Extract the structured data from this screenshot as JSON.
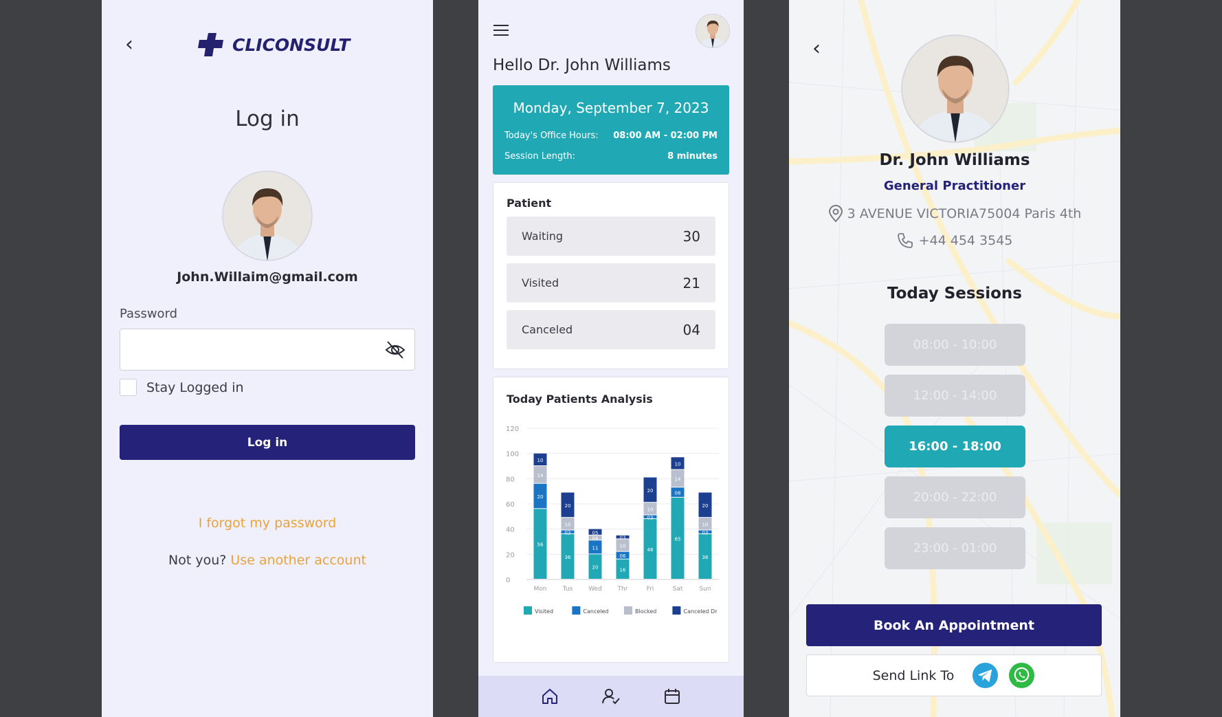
{
  "login": {
    "brand": "CLICONSULT",
    "title": "Log in",
    "email": "John.Willaim@gmail.com",
    "password_label": "Password",
    "stay_logged_in": "Stay Logged in",
    "login_button": "Log in",
    "forgot_password": "I forgot my password",
    "not_you": "Not you?",
    "use_another_account": "Use another account",
    "icons": [
      "back-chevron-icon",
      "brand-cross-icon",
      "eye-off-icon"
    ],
    "colors": {
      "brand": "#25227a",
      "link": "#e8a33d"
    }
  },
  "dashboard": {
    "greeting": "Hello Dr. John Williams",
    "date": "Monday, September 7, 2023",
    "office_hours_label": "Today's Office Hours:",
    "office_hours_value": "08:00 AM - 02:00 PM",
    "session_length_label": "Session Length:",
    "session_length_value": "8 minutes",
    "patient_title": "Patient",
    "stats": [
      {
        "label": "Waiting",
        "value": "30"
      },
      {
        "label": "Visited",
        "value": "21"
      },
      {
        "label": "Canceled",
        "value": "04"
      }
    ],
    "chart_title": "Today Patients Analysis",
    "nav_icons": [
      "home-icon",
      "patient-check-icon",
      "calendar-icon"
    ],
    "colors": {
      "accent": "#20a9b5"
    }
  },
  "chart_data": {
    "type": "bar",
    "stacked": true,
    "title": "Today Patients Analysis",
    "categories": [
      "Mon",
      "Tus",
      "Wed",
      "Thr",
      "Fri",
      "Sat",
      "Sun"
    ],
    "ylim": [
      0,
      120
    ],
    "yticks": [
      0,
      20,
      40,
      60,
      80,
      100,
      120
    ],
    "grid": true,
    "legend_position": "bottom",
    "series": [
      {
        "name": "Visited",
        "color": "#20a9b5",
        "values": [
          56,
          36,
          20,
          16,
          48,
          65,
          36
        ],
        "labels": [
          "56",
          "36",
          "20",
          "16",
          "48",
          "65",
          "36"
        ]
      },
      {
        "name": "Canceled",
        "color": "#1a75c4",
        "values": [
          20,
          3,
          11,
          6,
          3,
          8,
          3
        ],
        "labels": [
          "20",
          "03",
          "11",
          "06",
          "03",
          "08",
          "03"
        ]
      },
      {
        "name": "Blocked",
        "color": "#b9bfcc",
        "values": [
          14,
          10,
          4,
          10,
          10,
          14,
          10
        ],
        "labels": [
          "14",
          "10",
          "04",
          "10",
          "10",
          "14",
          "10"
        ]
      },
      {
        "name": "Canceled Dr",
        "color": "#1c3f8f",
        "values": [
          10,
          20,
          5,
          3,
          20,
          10,
          20
        ],
        "labels": [
          "10",
          "20",
          "05",
          "03",
          "20",
          "10",
          "20"
        ]
      }
    ]
  },
  "profile": {
    "name": "Dr. John Williams",
    "role": "General Practitioner",
    "address": "3 AVENUE VICTORIA75004 Paris 4th",
    "phone": "+44 454 3545",
    "sessions_title": "Today Sessions",
    "slots": [
      {
        "label": "08:00 - 10:00",
        "active": false
      },
      {
        "label": "12:00 - 14:00",
        "active": false
      },
      {
        "label": "16:00 - 18:00",
        "active": true
      },
      {
        "label": "20:00 - 22:00",
        "active": false
      },
      {
        "label": "23:00 - 01:00",
        "active": false
      }
    ],
    "book_button": "Book An Appointment",
    "send_link": "Send Link To",
    "icons": [
      "back-chevron-icon",
      "location-pin-icon",
      "phone-icon",
      "telegram-icon",
      "whatsapp-icon"
    ]
  }
}
